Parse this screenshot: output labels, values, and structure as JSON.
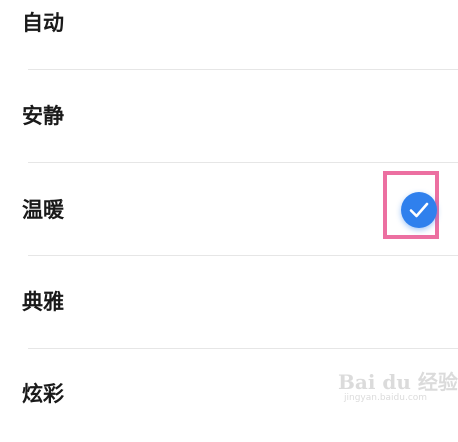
{
  "options": [
    {
      "label": "自动",
      "selected": false
    },
    {
      "label": "安静",
      "selected": false
    },
    {
      "label": "温暖",
      "selected": true
    },
    {
      "label": "典雅",
      "selected": false
    },
    {
      "label": "炫彩",
      "selected": false
    }
  ],
  "colors": {
    "check_fill": "#2f80ed",
    "highlight_border": "#ec6fa1",
    "divider": "#e6e6e6",
    "text": "#1a1a1a"
  },
  "icons": {
    "selected_indicator": "check-circle-icon"
  },
  "watermark": {
    "logo_text": "Bai du 经验",
    "url_text": "jingyan.baidu.com"
  }
}
